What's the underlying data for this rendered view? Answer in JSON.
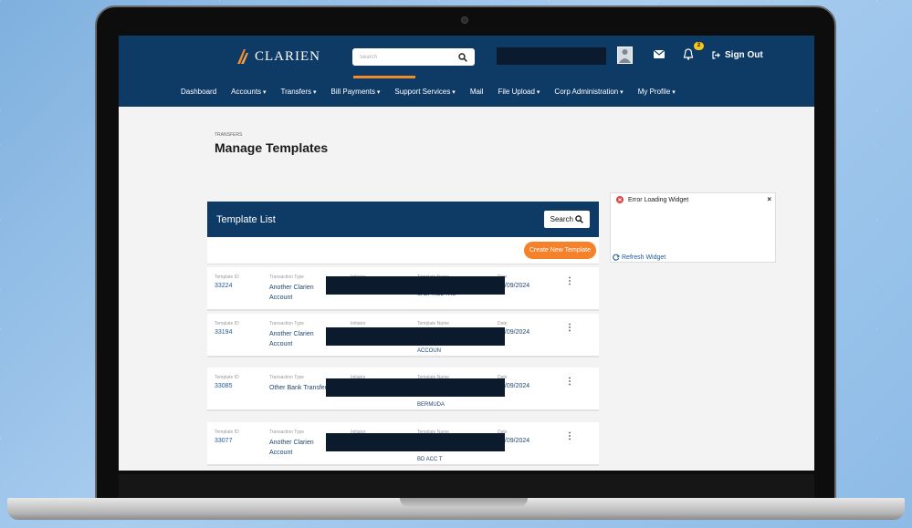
{
  "header": {
    "brand": "CLARIEN",
    "search_placeholder": "Search",
    "notification_count": "2",
    "signout_label": "Sign Out"
  },
  "nav": [
    {
      "label": "Dashboard"
    },
    {
      "label": "Accounts"
    },
    {
      "label": "Transfers"
    },
    {
      "label": "Bill Payments"
    },
    {
      "label": "Support Services"
    },
    {
      "label": "Mail"
    },
    {
      "label": "File Upload"
    },
    {
      "label": "Corp Administration"
    },
    {
      "label": "My Profile"
    }
  ],
  "page": {
    "breadcrumb": "TRANSFERS",
    "title": "Manage Templates"
  },
  "panel": {
    "title": "Template List",
    "search_label": "Search",
    "create_label": "Create New Template",
    "labels": {
      "id": "Template ID",
      "type": "Transaction Type",
      "initiator": "Initiator",
      "name": "Template Name",
      "date": "Date"
    },
    "rows": [
      {
        "id": "33224",
        "type": "Another Clarien Account",
        "name": "SALT HILL TRU",
        "date": "2/09/2024"
      },
      {
        "id": "33194",
        "type": "Another Clarien Account",
        "name": "ACCOUN",
        "date": "2/09/2024"
      },
      {
        "id": "33085",
        "type": "Other Bank Transfer",
        "name": "BERMUDA",
        "date": "2/09/2024"
      },
      {
        "id": "33077",
        "type": "Another Clarien Account",
        "name": "BD ACC T",
        "date": "2/09/2024"
      }
    ]
  },
  "widget": {
    "error": "Error Loading Widget",
    "refresh": "Refresh Widget"
  },
  "colors": {
    "navy": "#0e3a66",
    "orange": "#f5812a",
    "link": "#1d5a99"
  }
}
